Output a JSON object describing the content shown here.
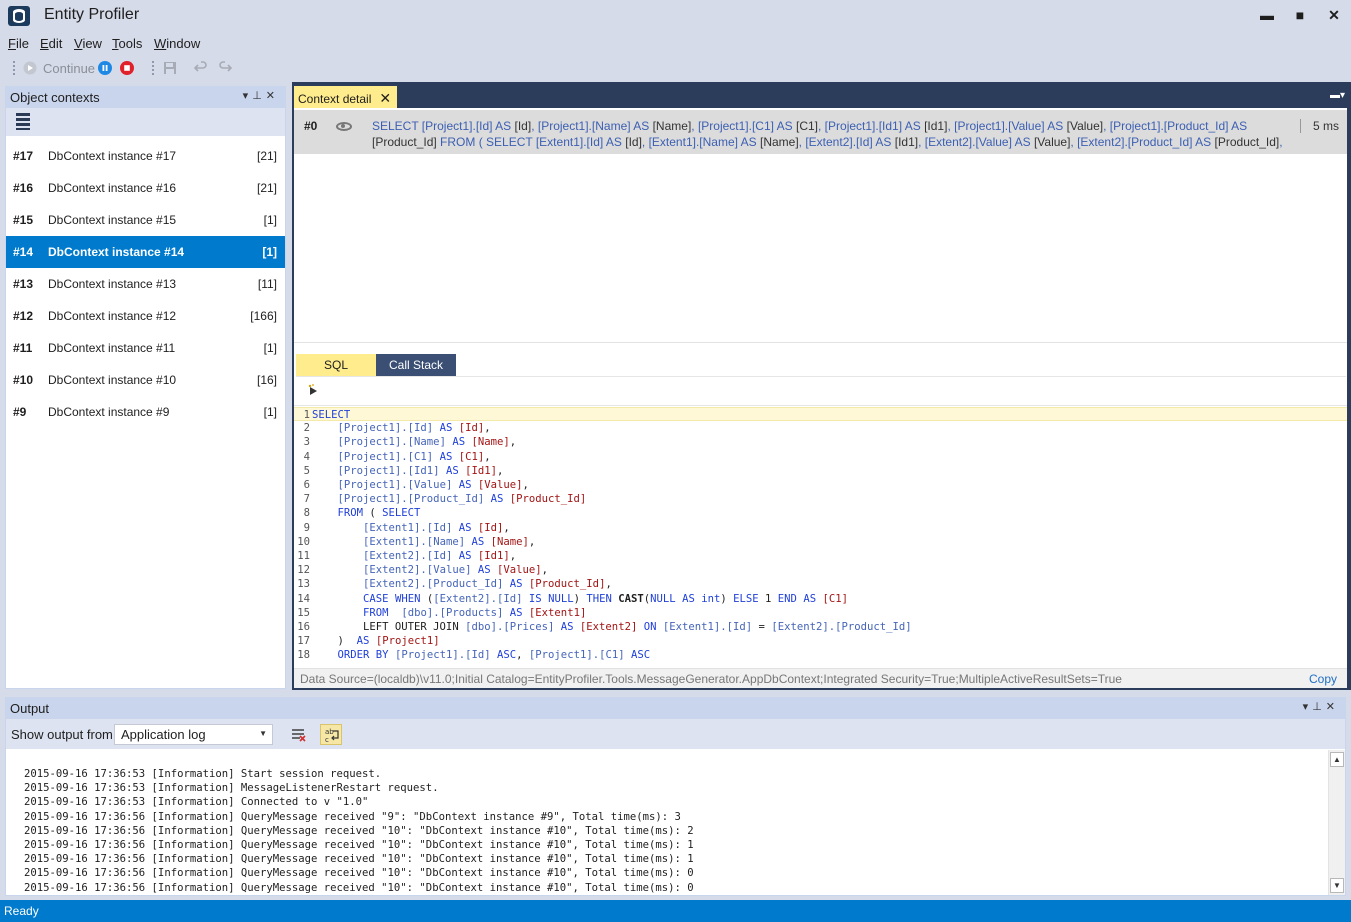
{
  "app": {
    "title": "Entity Profiler",
    "minimize": "▬",
    "maximize": "■",
    "close": "✕"
  },
  "menu": [
    {
      "label": "File",
      "hotkey": "F",
      "rest": "ile"
    },
    {
      "label": "Edit",
      "hotkey": "E",
      "rest": "dit"
    },
    {
      "label": "View",
      "hotkey": "V",
      "rest": "iew"
    },
    {
      "label": "Tools",
      "hotkey": "T",
      "rest": "ools"
    },
    {
      "label": "Window",
      "hotkey": "W",
      "rest": "indow"
    }
  ],
  "toolbar": {
    "continue_label": "Continue",
    "icons": [
      "play-icon",
      "pause-icon",
      "stop-icon",
      "save-icon",
      "undo-icon",
      "redo-icon"
    ]
  },
  "object_contexts": {
    "title": "Object contexts",
    "items": [
      {
        "num": "#17",
        "name": "DbContext instance #17",
        "count": "[21]",
        "selected": false
      },
      {
        "num": "#16",
        "name": "DbContext instance #16",
        "count": "[21]",
        "selected": false
      },
      {
        "num": "#15",
        "name": "DbContext instance #15",
        "count": "[1]",
        "selected": false
      },
      {
        "num": "#14",
        "name": "DbContext instance #14",
        "count": "[1]",
        "selected": true
      },
      {
        "num": "#13",
        "name": "DbContext instance #13",
        "count": "[11]",
        "selected": false
      },
      {
        "num": "#12",
        "name": "DbContext instance #12",
        "count": "[166]",
        "selected": false
      },
      {
        "num": "#11",
        "name": "DbContext instance #11",
        "count": "[1]",
        "selected": false
      },
      {
        "num": "#10",
        "name": "DbContext instance #10",
        "count": "[16]",
        "selected": false
      },
      {
        "num": "#9",
        "name": "DbContext instance #9",
        "count": "[1]",
        "selected": false
      }
    ]
  },
  "context_detail": {
    "tab_label": "Context detail",
    "query": {
      "num": "#0",
      "sql_line1": "SELECT [Project1].[Id] AS [Id], [Project1].[Name] AS [Name], [Project1].[C1] AS [C1], [Project1].[Id1] AS [Id1], [Project1].[Value] AS [Value], [Project1].[Product_Id] AS",
      "sql_line2": "[Product_Id] FROM ( SELECT [Extent1].[Id] AS [Id], [Extent1].[Name] AS [Name], [Extent2].[Id] AS [Id1], [Extent2].[Value] AS [Value], [Extent2].[Product_Id] AS [Product_Id], CAS...",
      "time": "5 ms"
    },
    "tabs": [
      "SQL",
      "Call Stack"
    ],
    "sql_lines": [
      "SELECT",
      "    [Project1].[Id] AS [Id],",
      "    [Project1].[Name] AS [Name],",
      "    [Project1].[C1] AS [C1],",
      "    [Project1].[Id1] AS [Id1],",
      "    [Project1].[Value] AS [Value],",
      "    [Project1].[Product_Id] AS [Product_Id]",
      "    FROM ( SELECT",
      "        [Extent1].[Id] AS [Id],",
      "        [Extent1].[Name] AS [Name],",
      "        [Extent2].[Id] AS [Id1],",
      "        [Extent2].[Value] AS [Value],",
      "        [Extent2].[Product_Id] AS [Product_Id],",
      "        CASE WHEN ([Extent2].[Id] IS NULL) THEN CAST(NULL AS int) ELSE 1 END AS [C1]",
      "        FROM  [dbo].[Products] AS [Extent1]",
      "        LEFT OUTER JOIN [dbo].[Prices] AS [Extent2] ON [Extent1].[Id] = [Extent2].[Product_Id]",
      "    )  AS [Project1]",
      "    ORDER BY [Project1].[Id] ASC, [Project1].[C1] ASC"
    ],
    "connection_string": "Data Source=(localdb)\\v11.0;Initial Catalog=EntityProfiler.Tools.MessageGenerator.AppDbContext;Integrated Security=True;MultipleActiveResultSets=True",
    "copy_label": "Copy"
  },
  "output": {
    "title": "Output",
    "show_from_label": "Show output from:",
    "source_value": "Application log",
    "lines": [
      "2015-09-16 17:36:53 [Information] Start session request.",
      "2015-09-16 17:36:53 [Information] MessageListenerRestart request.",
      "2015-09-16 17:36:53 [Information] Connected to v \"1.0\"",
      "2015-09-16 17:36:56 [Information] QueryMessage received \"9\": \"DbContext instance #9\", Total time(ms): 3",
      "2015-09-16 17:36:56 [Information] QueryMessage received \"10\": \"DbContext instance #10\", Total time(ms): 2",
      "2015-09-16 17:36:56 [Information] QueryMessage received \"10\": \"DbContext instance #10\", Total time(ms): 1",
      "2015-09-16 17:36:56 [Information] QueryMessage received \"10\": \"DbContext instance #10\", Total time(ms): 1",
      "2015-09-16 17:36:56 [Information] QueryMessage received \"10\": \"DbContext instance #10\", Total time(ms): 0",
      "2015-09-16 17:36:56 [Information] QueryMessage received \"10\": \"DbContext instance #10\", Total time(ms): 0"
    ]
  },
  "status": {
    "text": "Ready"
  }
}
